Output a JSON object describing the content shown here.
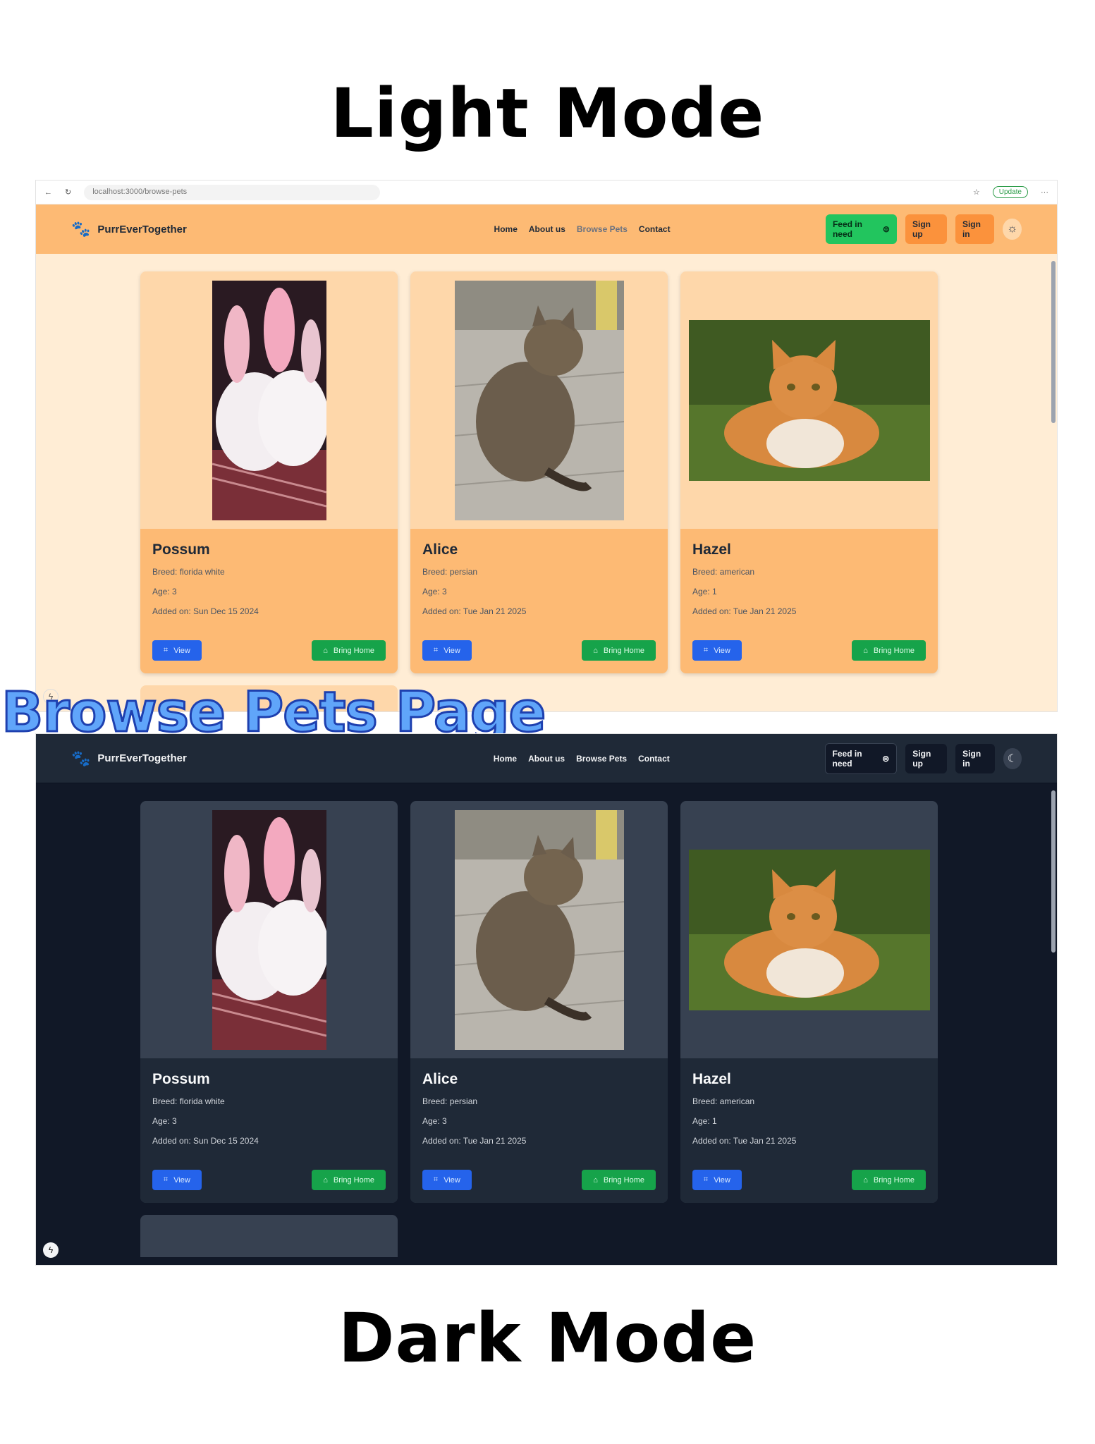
{
  "headings": {
    "light": "Light Mode",
    "dark": "Dark Mode",
    "section": "Browse Pets Page"
  },
  "browser": {
    "url": "localhost:3000/browse-pets",
    "update_label": "Update"
  },
  "navbar": {
    "brand": "PurrEverTogether",
    "links": [
      "Home",
      "About us",
      "Browse Pets",
      "Contact"
    ],
    "active_link": "Browse Pets",
    "feed_label": "Feed in need",
    "signup_label": "Sign up",
    "signin_label": "Sign in"
  },
  "card_labels": {
    "view": "View",
    "bring_home": "Bring Home"
  },
  "pets": [
    {
      "name": "Possum",
      "breed": "Breed: florida white",
      "age": "Age: 3",
      "added": "Added on: Sun Dec 15 2024",
      "image": "white-rabbits-photo"
    },
    {
      "name": "Alice",
      "breed": "Breed: persian",
      "age": "Age: 3",
      "added": "Added on: Tue Jan 21 2025",
      "image": "tabby-cat-photo"
    },
    {
      "name": "Hazel",
      "breed": "Breed: american",
      "age": "Age: 1",
      "added": "Added on: Tue Jan 21 2025",
      "image": "orange-cat-photo"
    }
  ],
  "colors": {
    "light_bg": "#ffedd5",
    "light_nav": "#fdba74",
    "light_card": "#fed7aa",
    "dark_bg": "#111827",
    "dark_nav": "#1f2937",
    "dark_card": "#374151",
    "view_button": "#2563eb",
    "bring_home_button": "#16a34a"
  }
}
